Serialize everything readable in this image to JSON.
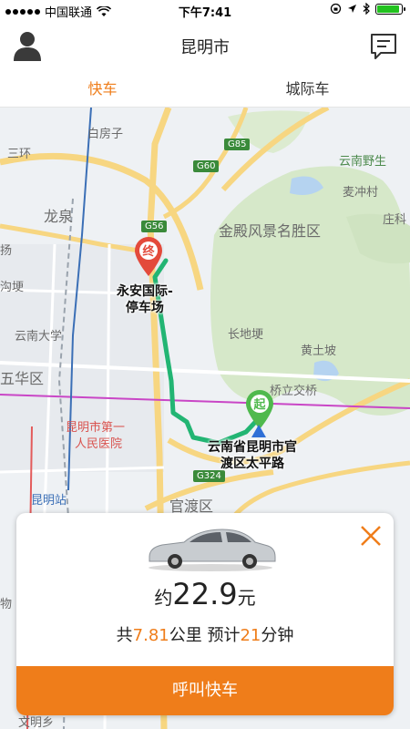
{
  "status_bar": {
    "carrier": "中国联通",
    "time": "下午7:41",
    "battery_percent": 92
  },
  "header": {
    "title": "昆明市",
    "icons": {
      "left": "user-avatar-icon",
      "right": "message-icon"
    }
  },
  "tabs": [
    {
      "label": "快车",
      "active": true
    },
    {
      "label": "城际车",
      "active": false
    }
  ],
  "map": {
    "labels": {
      "baifangzi": "白房子",
      "sanhuan": "三环",
      "longquan": "龙泉",
      "yunnan_ye": "云南野生",
      "maichongcun": "麦冲村",
      "zhuangke": "庄科",
      "jindian": "金殿风景名胜区",
      "yang": "扬",
      "gouyan": "沟埂",
      "yunnan_univ": "云南大学",
      "wuhua": "五华区",
      "changdigeng": "长地埂",
      "huangtupo": "黄土坡",
      "bridge": "桥立交桥",
      "hospital": "昆明市第一人民医院",
      "hospital_line1": "昆明市第一",
      "hospital_line2": "人民医院",
      "kunming_station": "昆明站",
      "guandu": "官渡区",
      "wu": "物",
      "wenming": "文明乡"
    },
    "road_signs": {
      "g85": "G85",
      "g60": "G60",
      "g56": "G56",
      "g324": "G324"
    },
    "end_marker": "终",
    "start_marker": "起",
    "destination": {
      "line1": "永安国际-",
      "line2": "停车场"
    },
    "origin": {
      "line1": "云南省昆明市官",
      "line2": "渡区太平路"
    }
  },
  "ride_card": {
    "fare_prefix": "约",
    "fare_amount": "22.9",
    "fare_unit": "元",
    "trip_prefix": "共",
    "distance": "7.81",
    "distance_unit": "公里 预计",
    "duration": "21",
    "duration_unit": "分钟",
    "call_button": "呼叫快车",
    "icons": {
      "close": "close-icon",
      "car": "car-icon"
    }
  },
  "colors": {
    "accent": "#ef7d1a",
    "route": "#22b573",
    "end_marker": "#e34a3b",
    "start_marker": "#4fb94d"
  }
}
